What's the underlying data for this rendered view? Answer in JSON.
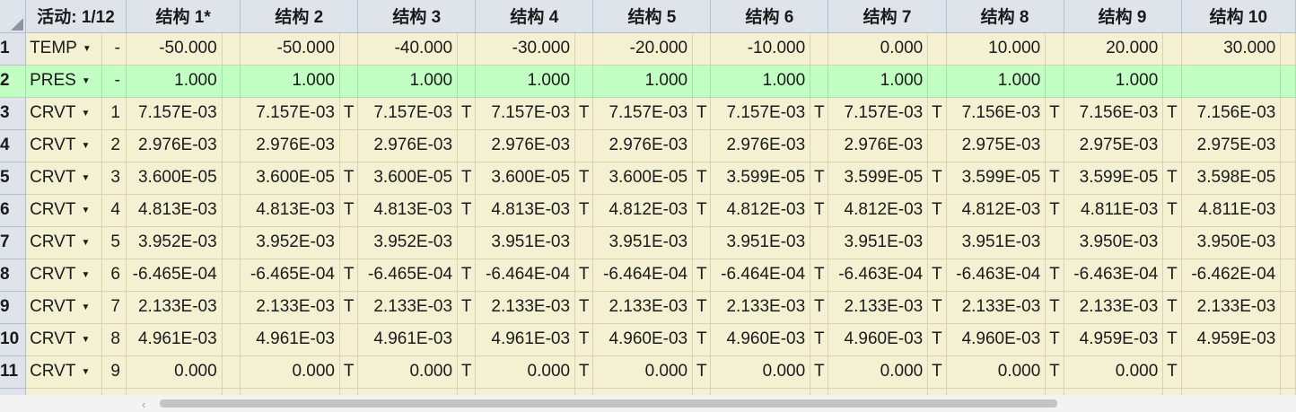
{
  "header": {
    "active_label": "活动: 1/12",
    "columns": [
      "结构 1*",
      "结构 2",
      "结构 3",
      "结构 4",
      "结构 5",
      "结构 6",
      "结构 7",
      "结构 8",
      "结构 9",
      "结构 10"
    ]
  },
  "rows": [
    {
      "num": "1",
      "param": "TEMP",
      "idx": "-",
      "values": [
        "-50.000",
        "-50.000",
        "-40.000",
        "-30.000",
        "-20.000",
        "-10.000",
        "0.000",
        "10.000",
        "20.000",
        "30.000"
      ],
      "flags": [
        "",
        "",
        "",
        "",
        "",
        "",
        "",
        "",
        ""
      ]
    },
    {
      "num": "2",
      "param": "PRES",
      "idx": "-",
      "values": [
        "1.000",
        "1.000",
        "1.000",
        "1.000",
        "1.000",
        "1.000",
        "1.000",
        "1.000",
        "1.000",
        ""
      ],
      "flags": [
        "",
        "",
        "",
        "",
        "",
        "",
        "",
        "",
        ""
      ]
    },
    {
      "num": "3",
      "param": "CRVT",
      "idx": "1",
      "values": [
        "7.157E-03",
        "7.157E-03",
        "7.157E-03",
        "7.157E-03",
        "7.157E-03",
        "7.157E-03",
        "7.157E-03",
        "7.156E-03",
        "7.156E-03",
        "7.156E-03"
      ],
      "flags": [
        "",
        "T",
        "T",
        "T",
        "T",
        "T",
        "T",
        "T",
        "T"
      ]
    },
    {
      "num": "4",
      "param": "CRVT",
      "idx": "2",
      "values": [
        "2.976E-03",
        "2.976E-03",
        "2.976E-03",
        "2.976E-03",
        "2.976E-03",
        "2.976E-03",
        "2.976E-03",
        "2.975E-03",
        "2.975E-03",
        "2.975E-03"
      ],
      "flags": [
        "",
        "",
        "",
        "",
        "",
        "",
        "",
        "",
        ""
      ]
    },
    {
      "num": "5",
      "param": "CRVT",
      "idx": "3",
      "values": [
        "3.600E-05",
        "3.600E-05",
        "3.600E-05",
        "3.600E-05",
        "3.600E-05",
        "3.599E-05",
        "3.599E-05",
        "3.599E-05",
        "3.599E-05",
        "3.598E-05"
      ],
      "flags": [
        "",
        "T",
        "T",
        "T",
        "T",
        "T",
        "T",
        "T",
        "T"
      ]
    },
    {
      "num": "6",
      "param": "CRVT",
      "idx": "4",
      "values": [
        "4.813E-03",
        "4.813E-03",
        "4.813E-03",
        "4.813E-03",
        "4.812E-03",
        "4.812E-03",
        "4.812E-03",
        "4.812E-03",
        "4.811E-03",
        "4.811E-03"
      ],
      "flags": [
        "",
        "T",
        "T",
        "T",
        "T",
        "T",
        "T",
        "T",
        "T"
      ]
    },
    {
      "num": "7",
      "param": "CRVT",
      "idx": "5",
      "values": [
        "3.952E-03",
        "3.952E-03",
        "3.952E-03",
        "3.951E-03",
        "3.951E-03",
        "3.951E-03",
        "3.951E-03",
        "3.951E-03",
        "3.950E-03",
        "3.950E-03"
      ],
      "flags": [
        "",
        "",
        "",
        "",
        "",
        "",
        "",
        "",
        ""
      ]
    },
    {
      "num": "8",
      "param": "CRVT",
      "idx": "6",
      "values": [
        "-6.465E-04",
        "-6.465E-04",
        "-6.465E-04",
        "-6.464E-04",
        "-6.464E-04",
        "-6.464E-04",
        "-6.463E-04",
        "-6.463E-04",
        "-6.463E-04",
        "-6.462E-04"
      ],
      "flags": [
        "",
        "T",
        "T",
        "T",
        "T",
        "T",
        "T",
        "T",
        "T"
      ]
    },
    {
      "num": "9",
      "param": "CRVT",
      "idx": "7",
      "values": [
        "2.133E-03",
        "2.133E-03",
        "2.133E-03",
        "2.133E-03",
        "2.133E-03",
        "2.133E-03",
        "2.133E-03",
        "2.133E-03",
        "2.133E-03",
        "2.133E-03"
      ],
      "flags": [
        "",
        "T",
        "T",
        "T",
        "T",
        "T",
        "T",
        "T",
        "T"
      ]
    },
    {
      "num": "10",
      "param": "CRVT",
      "idx": "8",
      "values": [
        "4.961E-03",
        "4.961E-03",
        "4.961E-03",
        "4.961E-03",
        "4.960E-03",
        "4.960E-03",
        "4.960E-03",
        "4.960E-03",
        "4.959E-03",
        "4.959E-03"
      ],
      "flags": [
        "",
        "",
        "",
        "T",
        "T",
        "T",
        "T",
        "T",
        "T"
      ]
    },
    {
      "num": "11",
      "param": "CRVT",
      "idx": "9",
      "values": [
        "0.000",
        "0.000",
        "0.000",
        "0.000",
        "0.000",
        "0.000",
        "0.000",
        "0.000",
        "0.000",
        ""
      ],
      "flags": [
        "",
        "T",
        "T",
        "T",
        "T",
        "T",
        "T",
        "T",
        "T"
      ]
    },
    {
      "num": "",
      "param": "",
      "idx": "",
      "values": [
        "",
        "",
        "",
        "",
        "",
        "",
        "",
        "",
        "",
        ""
      ],
      "flags": [
        "",
        "",
        "",
        "",
        "",
        "",
        "",
        "",
        ""
      ]
    }
  ],
  "colors": {
    "header_bg": "#dfe4ea",
    "cell_bg": "#f4f1d2",
    "pres_row_bg": "#c2ffc2"
  },
  "icons": {
    "dropdown": "caret-down-icon",
    "scroll_left": "chevron-left-icon"
  }
}
